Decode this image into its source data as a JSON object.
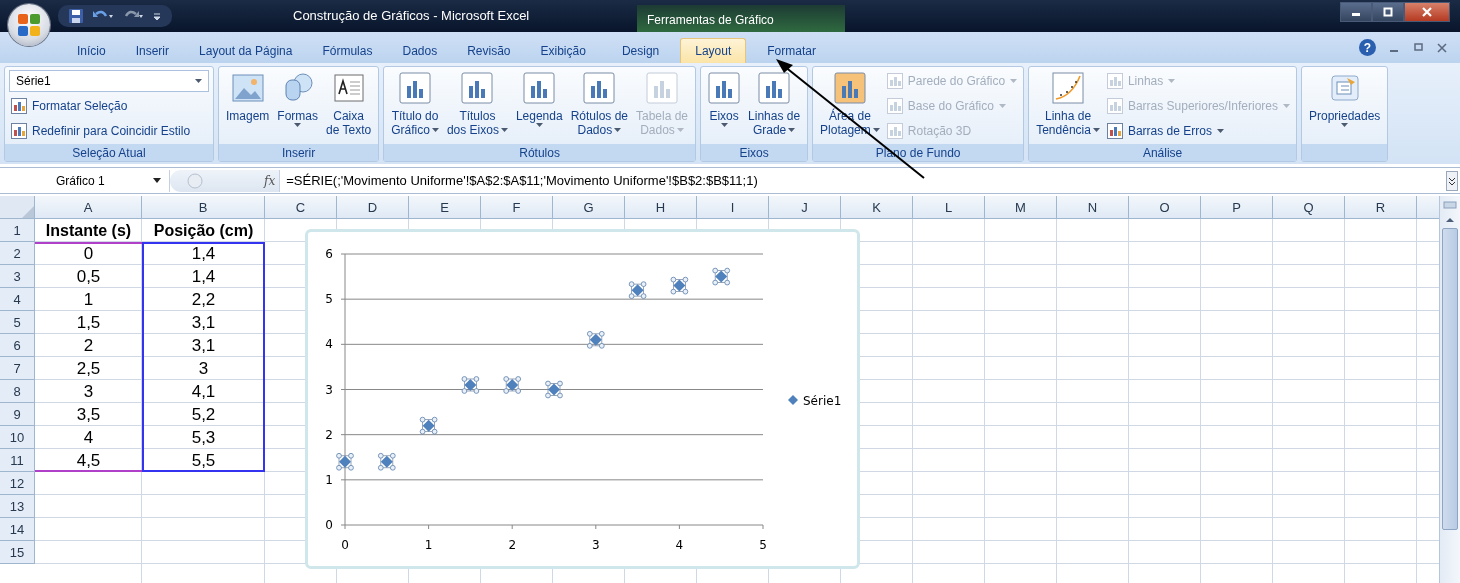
{
  "window": {
    "title": "Construção de Gráficos - Microsoft Excel",
    "context_group": "Ferramentas de Gráfico",
    "help_glyph": "?"
  },
  "tabs": [
    {
      "label": "Início",
      "selected": false,
      "kind": "normal"
    },
    {
      "label": "Inserir",
      "selected": false,
      "kind": "normal"
    },
    {
      "label": "Layout da Página",
      "selected": false,
      "kind": "normal"
    },
    {
      "label": "Fórmulas",
      "selected": false,
      "kind": "normal"
    },
    {
      "label": "Dados",
      "selected": false,
      "kind": "normal"
    },
    {
      "label": "Revisão",
      "selected": false,
      "kind": "normal"
    },
    {
      "label": "Exibição",
      "selected": false,
      "kind": "normal"
    },
    {
      "label": "Design",
      "selected": false,
      "kind": "context"
    },
    {
      "label": "Layout",
      "selected": true,
      "kind": "context"
    },
    {
      "label": "Formatar",
      "selected": false,
      "kind": "context"
    }
  ],
  "ribbon": {
    "groups": [
      {
        "label": "Seleção Atual",
        "items": [
          {
            "kind": "combo",
            "lines": [
              "Série1"
            ],
            "dropdown": true
          },
          {
            "kind": "small",
            "lines": [
              "Formatar Seleção"
            ],
            "dropdown": false,
            "disabled": false
          },
          {
            "kind": "small",
            "lines": [
              "Redefinir para Coincidir Estilo"
            ],
            "dropdown": false,
            "disabled": false
          }
        ]
      },
      {
        "label": "Inserir",
        "items": [
          {
            "kind": "large",
            "lines": [
              "Imagem"
            ],
            "dropdown": false,
            "disabled": false
          },
          {
            "kind": "large",
            "lines": [
              "Formas"
            ],
            "dropdown": true,
            "disabled": false
          },
          {
            "kind": "large",
            "lines": [
              "Caixa",
              "de Texto"
            ],
            "dropdown": false,
            "disabled": false
          }
        ]
      },
      {
        "label": "Rótulos",
        "items": [
          {
            "kind": "large",
            "lines": [
              "Título do",
              "Gráfico"
            ],
            "dropdown": true,
            "disabled": false
          },
          {
            "kind": "large",
            "lines": [
              "Títulos",
              "dos Eixos"
            ],
            "dropdown": true,
            "disabled": false
          },
          {
            "kind": "large",
            "lines": [
              "Legenda"
            ],
            "dropdown": true,
            "disabled": false
          },
          {
            "kind": "large",
            "lines": [
              "Rótulos de",
              "Dados"
            ],
            "dropdown": true,
            "disabled": false
          },
          {
            "kind": "large",
            "lines": [
              "Tabela de",
              "Dados"
            ],
            "dropdown": true,
            "disabled": true
          }
        ]
      },
      {
        "label": "Eixos",
        "items": [
          {
            "kind": "large",
            "lines": [
              "Eixos"
            ],
            "dropdown": true,
            "disabled": false
          },
          {
            "kind": "large",
            "lines": [
              "Linhas de",
              "Grade"
            ],
            "dropdown": true,
            "disabled": false
          }
        ]
      },
      {
        "label": "Plano de Fundo",
        "items": [
          {
            "kind": "large",
            "lines": [
              "Área de",
              "Plotagem"
            ],
            "dropdown": true,
            "disabled": false
          },
          {
            "kind": "small",
            "lines": [
              "Parede do Gráfico"
            ],
            "dropdown": true,
            "disabled": true
          },
          {
            "kind": "small",
            "lines": [
              "Base do Gráfico"
            ],
            "dropdown": true,
            "disabled": true
          },
          {
            "kind": "small",
            "lines": [
              "Rotação 3D"
            ],
            "dropdown": false,
            "disabled": true
          }
        ]
      },
      {
        "label": "Análise",
        "items": [
          {
            "kind": "large",
            "lines": [
              "Linha de",
              "Tendência"
            ],
            "dropdown": true,
            "disabled": false
          },
          {
            "kind": "small",
            "lines": [
              "Linhas"
            ],
            "dropdown": true,
            "disabled": true
          },
          {
            "kind": "small",
            "lines": [
              "Barras Superiores/Inferiores"
            ],
            "dropdown": true,
            "disabled": true
          },
          {
            "kind": "small",
            "lines": [
              "Barras de Erros"
            ],
            "dropdown": true,
            "disabled": false
          }
        ]
      },
      {
        "items": [
          {
            "kind": "large",
            "lines": [
              "Propriedades"
            ],
            "dropdown": true,
            "disabled": false
          }
        ]
      }
    ]
  },
  "formula_bar": {
    "name_box": "Gráfico 1",
    "fx": "fx",
    "formula": "=SÉRIE(;'Movimento Uniforme'!$A$2:$A$11;'Movimento Uniforme'!$B$2:$B$11;1)"
  },
  "columns": [
    "A",
    "B",
    "C",
    "D",
    "E",
    "F",
    "G",
    "H",
    "I",
    "J",
    "K",
    "L",
    "M",
    "N",
    "O",
    "P",
    "Q",
    "R"
  ],
  "rows": [
    {
      "number": "1",
      "cells": [
        "Instante (s)",
        "Posição (cm)"
      ]
    },
    {
      "number": "2",
      "cells": [
        "0",
        "1,4"
      ]
    },
    {
      "number": "3",
      "cells": [
        "0,5",
        "1,4"
      ]
    },
    {
      "number": "4",
      "cells": [
        "1",
        "2,2"
      ]
    },
    {
      "number": "5",
      "cells": [
        "1,5",
        "3,1"
      ]
    },
    {
      "number": "6",
      "cells": [
        "2",
        "3,1"
      ]
    },
    {
      "number": "7",
      "cells": [
        "2,5",
        "3"
      ]
    },
    {
      "number": "8",
      "cells": [
        "3",
        "4,1"
      ]
    },
    {
      "number": "9",
      "cells": [
        "3,5",
        "5,2"
      ]
    },
    {
      "number": "10",
      "cells": [
        "4",
        "5,3"
      ]
    },
    {
      "number": "11",
      "cells": [
        "4,5",
        "5,5"
      ]
    },
    {
      "number": "12",
      "cells": []
    },
    {
      "number": "13",
      "cells": []
    },
    {
      "number": "14",
      "cells": []
    },
    {
      "number": "15",
      "cells": []
    }
  ],
  "chart": {
    "chart_data": {
      "type": "scatter",
      "x": [
        0,
        0.5,
        1,
        1.5,
        2,
        2.5,
        3,
        3.5,
        4,
        4.5
      ],
      "series": [
        {
          "name": "Série1",
          "color": "#4f81bd",
          "values": [
            1.4,
            1.4,
            2.2,
            3.1,
            3.1,
            3,
            4.1,
            5.2,
            5.3,
            5.5
          ]
        }
      ],
      "xlim": [
        0,
        5
      ],
      "ylim": [
        0,
        6
      ],
      "xticks": [
        0,
        1,
        2,
        3,
        4,
        5
      ],
      "yticks": [
        0,
        1,
        2,
        3,
        4,
        5,
        6
      ],
      "grid": true
    }
  }
}
